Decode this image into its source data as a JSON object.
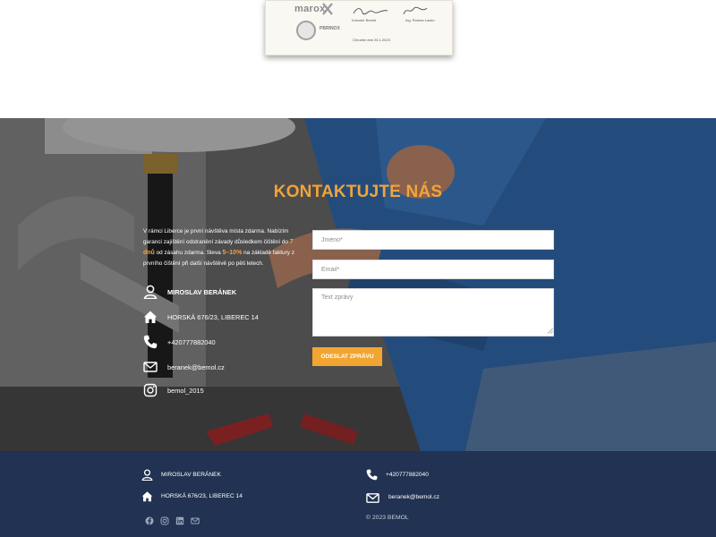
{
  "certificate": {
    "logo_marox": "marox",
    "logo_pbrinox": "PBRINOX",
    "signer_one": "Ľubomír Beneš",
    "signer_two": "Ing. Roman Lacko",
    "date_line": "Chrudim dne 26.1.2023"
  },
  "contact": {
    "title": "KONTAKTUJTE NÁS",
    "intro_part1": "V rámci Liberce je první návštěva místa zdarma. Nabízím garanci zajištění odstranění závady důsledkem čištění do ",
    "intro_hl1": "7 dnů",
    "intro_part2": " od zásahu zdarma. Sleva ",
    "intro_hl2": "5–10%",
    "intro_part3": " na základě faktury z prvního čištění při další návštěvě po pěti letech.",
    "name": "MIROSLAV BERÁNEK",
    "address": "HORSKÁ 676/23, LIBEREC 14",
    "phone": "+420777882040",
    "email": "beranek@bemol.cz",
    "instagram": "bemol_2015",
    "form": {
      "name_placeholder": "Jméno*",
      "email_placeholder": "Email*",
      "message_placeholder": "Text zprávy",
      "submit_label": "ODESLAT ZPRÁVU"
    }
  },
  "footer": {
    "name": "MIROSLAV BERÁNEK",
    "address": "HORSKÁ 676/23, LIBEREC 14",
    "phone": "+420777882040",
    "email": "beranek@bemol.cz",
    "copyright": "© 2023 BEMOL",
    "social_icons": [
      "facebook-icon",
      "instagram-icon",
      "linkedin-icon",
      "mail-icon"
    ]
  },
  "colors": {
    "accent": "#f0a43a",
    "footer_bg": "#213252",
    "button_bg": "#f2a531"
  }
}
